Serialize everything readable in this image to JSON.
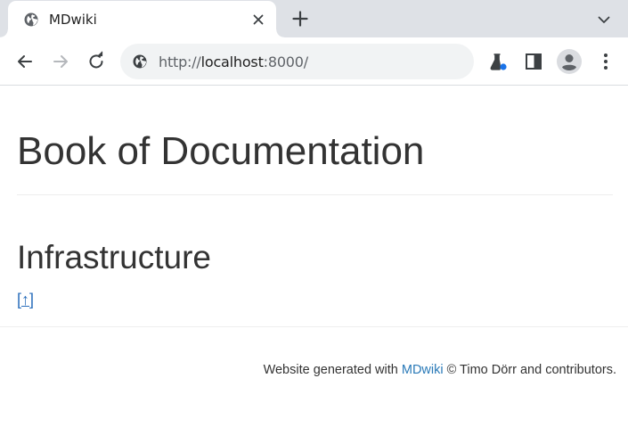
{
  "browser": {
    "tab": {
      "title": "MDwiki"
    },
    "address": {
      "scheme": "http://",
      "host": "localhost",
      "rest": ":8000/"
    },
    "icons": {
      "favicon": "globe-icon",
      "close": "close-icon",
      "new_tab": "plus-icon",
      "tab_search": "chevron-down-icon",
      "back": "back-arrow-icon",
      "forward": "forward-arrow-icon",
      "reload": "reload-icon",
      "site_info": "globe-icon",
      "labs": "flask-icon",
      "side_panel": "side-panel-icon",
      "profile": "profile-avatar-icon",
      "menu": "kebab-menu-icon"
    },
    "colors": {
      "tabstrip": "#dee1e6",
      "omnibox": "#f1f3f4",
      "labs_dot": "#1a73e8"
    }
  },
  "page": {
    "title": "Book of Documentation",
    "section_heading": "Infrastructure",
    "up_link": {
      "open": "[",
      "arrow": "↑",
      "close": "]"
    },
    "footer": {
      "prefix": "Website generated with ",
      "link": "MDwiki",
      "suffix": " © Timo Dörr and contributors."
    },
    "colors": {
      "text": "#333333",
      "link": "#2a6ebb"
    }
  }
}
